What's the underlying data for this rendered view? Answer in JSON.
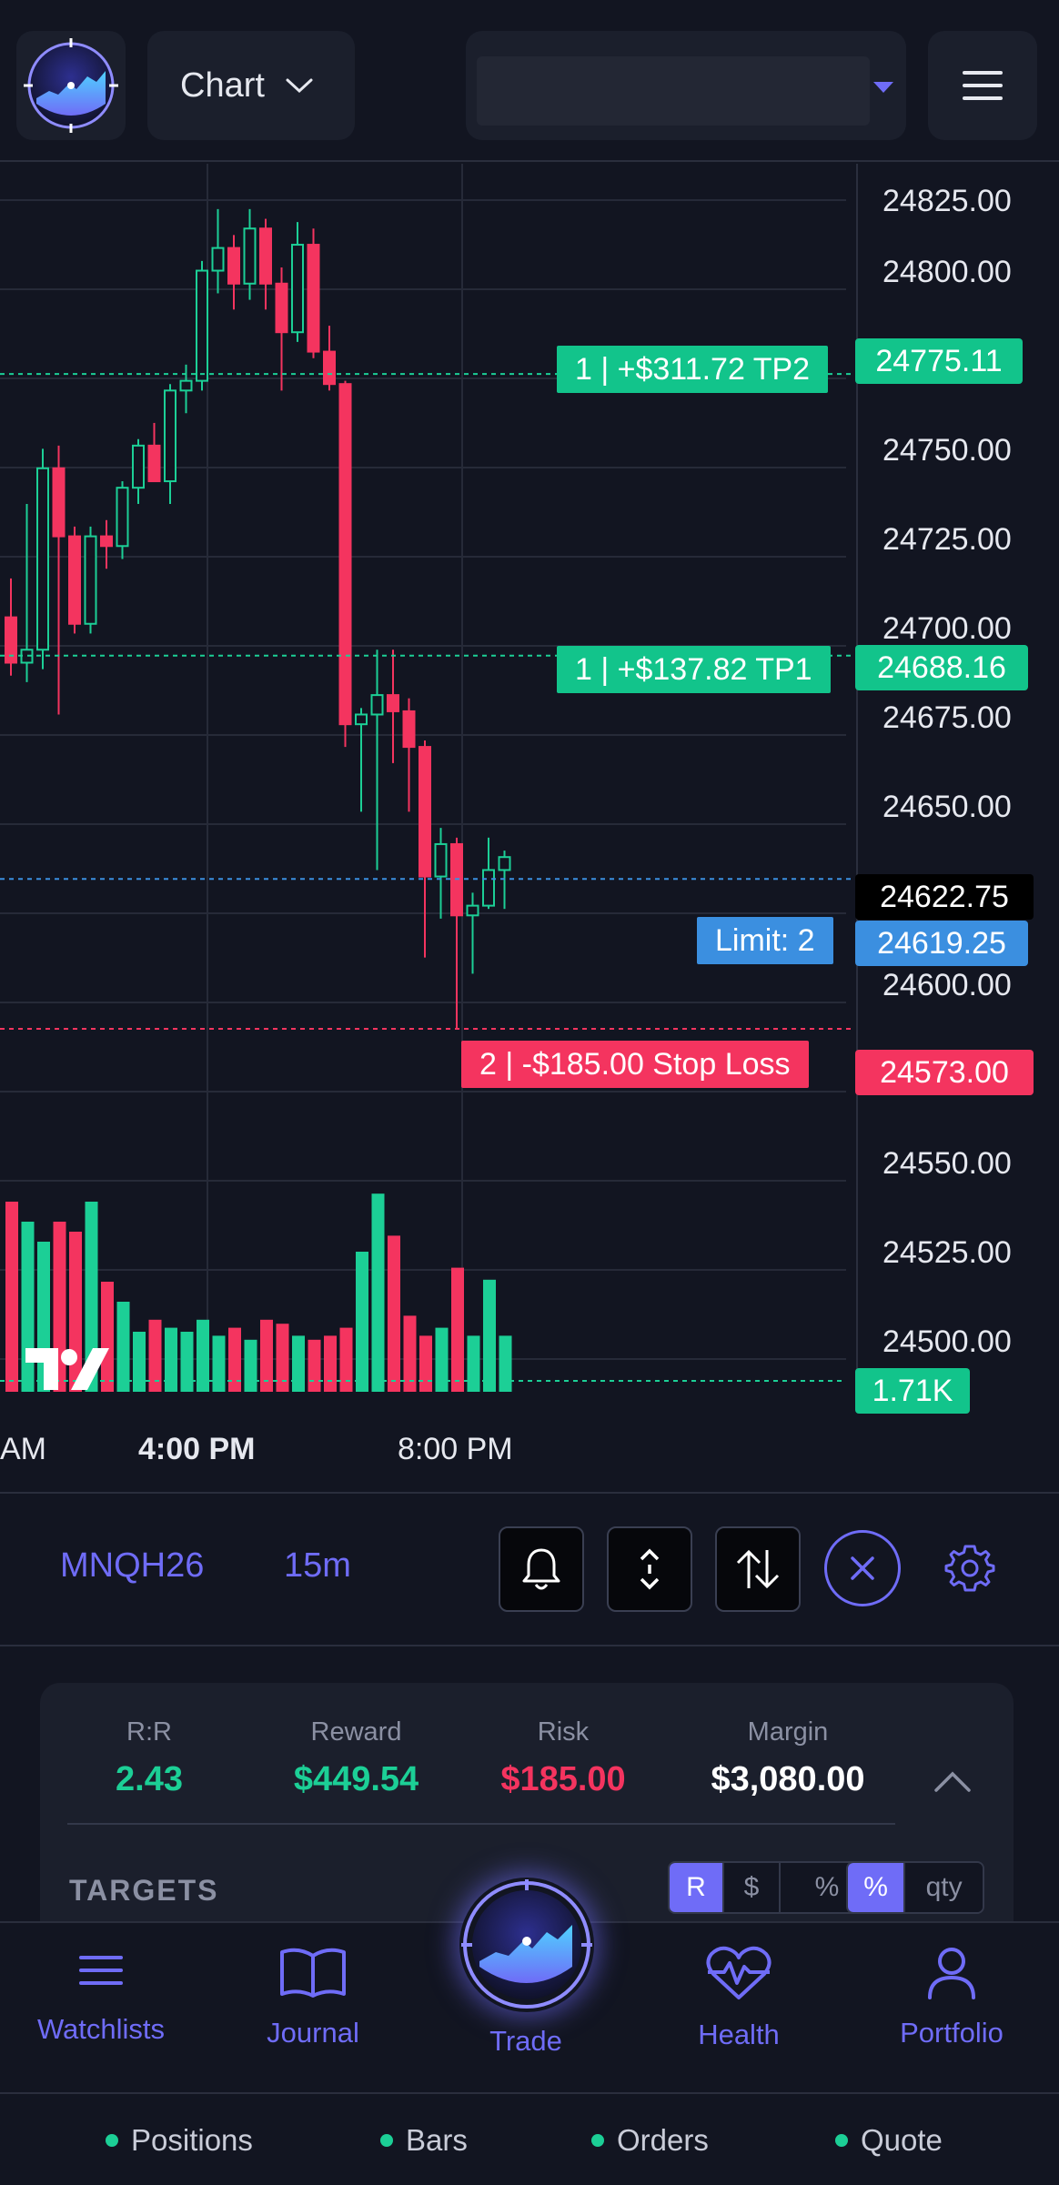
{
  "header": {
    "view_label": "Chart",
    "icons": {
      "logo": "radar-logo-icon",
      "chevron": "chevron-down-icon",
      "menu": "hamburger-menu-icon",
      "account_caret": "caret-down-icon"
    }
  },
  "chart": {
    "price_axis": [
      "24825.00",
      "24800.00",
      "24750.00",
      "24725.00",
      "24700.00",
      "24675.00",
      "24650.00",
      "24600.00",
      "24550.00",
      "24525.00",
      "24500.00"
    ],
    "time_axis": [
      "AM",
      "4:00 PM",
      "8:00 PM"
    ],
    "markers": {
      "tp2_price": "24775.11",
      "tp1_price": "24688.16",
      "last_price": "24622.75",
      "limit_price": "24619.25",
      "stop_price": "24573.00",
      "volume": "1.71K"
    },
    "orders": {
      "tp2": "1 | +$311.72 TP2",
      "tp1": "1 | +$137.82 TP1",
      "limit": "Limit: 2",
      "stop": "2 | -$185.00 Stop Loss"
    },
    "colors": {
      "up": "#1ccf96",
      "down": "#f4345f",
      "limit": "#3b8fe0",
      "background": "#121521",
      "grid": "#262a38"
    }
  },
  "chart_data": {
    "type": "candlestick",
    "y_range": [
      24475,
      24840
    ],
    "candles": [
      {
        "o": 24700,
        "h": 24712,
        "l": 24682,
        "c": 24686
      },
      {
        "o": 24686,
        "h": 24735,
        "l": 24680,
        "c": 24690
      },
      {
        "o": 24690,
        "h": 24752,
        "l": 24684,
        "c": 24746
      },
      {
        "o": 24746,
        "h": 24753,
        "l": 24670,
        "c": 24725
      },
      {
        "o": 24725,
        "h": 24728,
        "l": 24695,
        "c": 24698
      },
      {
        "o": 24698,
        "h": 24728,
        "l": 24695,
        "c": 24725
      },
      {
        "o": 24725,
        "h": 24730,
        "l": 24715,
        "c": 24722
      },
      {
        "o": 24722,
        "h": 24742,
        "l": 24718,
        "c": 24740
      },
      {
        "o": 24740,
        "h": 24755,
        "l": 24735,
        "c": 24753
      },
      {
        "o": 24753,
        "h": 24760,
        "l": 24742,
        "c": 24742
      },
      {
        "o": 24742,
        "h": 24772,
        "l": 24735,
        "c": 24770
      },
      {
        "o": 24770,
        "h": 24778,
        "l": 24763,
        "c": 24773
      },
      {
        "o": 24773,
        "h": 24810,
        "l": 24770,
        "c": 24807
      },
      {
        "o": 24807,
        "h": 24826,
        "l": 24800,
        "c": 24814
      },
      {
        "o": 24814,
        "h": 24818,
        "l": 24795,
        "c": 24803
      },
      {
        "o": 24803,
        "h": 24826,
        "l": 24798,
        "c": 24820
      },
      {
        "o": 24820,
        "h": 24823,
        "l": 24795,
        "c": 24803
      },
      {
        "o": 24803,
        "h": 24808,
        "l": 24770,
        "c": 24788
      },
      {
        "o": 24788,
        "h": 24822,
        "l": 24785,
        "c": 24815
      },
      {
        "o": 24815,
        "h": 24820,
        "l": 24780,
        "c": 24782
      },
      {
        "o": 24782,
        "h": 24790,
        "l": 24770,
        "c": 24772
      },
      {
        "o": 24772,
        "h": 24773,
        "l": 24660,
        "c": 24667
      },
      {
        "o": 24667,
        "h": 24672,
        "l": 24640,
        "c": 24670
      },
      {
        "o": 24670,
        "h": 24690,
        "l": 24622,
        "c": 24676
      },
      {
        "o": 24676,
        "h": 24690,
        "l": 24655,
        "c": 24671
      },
      {
        "o": 24671,
        "h": 24675,
        "l": 24640,
        "c": 24660
      },
      {
        "o": 24660,
        "h": 24662,
        "l": 24595,
        "c": 24620
      },
      {
        "o": 24620,
        "h": 24635,
        "l": 24607,
        "c": 24630
      },
      {
        "o": 24630,
        "h": 24632,
        "l": 24573,
        "c": 24608
      },
      {
        "o": 24608,
        "h": 24615,
        "l": 24590,
        "c": 24611
      },
      {
        "o": 24611,
        "h": 24632,
        "l": 24610,
        "c": 24622
      },
      {
        "o": 24622,
        "h": 24628,
        "l": 24610,
        "c": 24626
      }
    ],
    "volume_relative": [
      0.95,
      0.85,
      0.75,
      0.85,
      0.8,
      0.95,
      0.55,
      0.45,
      0.3,
      0.36,
      0.32,
      0.3,
      0.36,
      0.28,
      0.32,
      0.26,
      0.36,
      0.34,
      0.28,
      0.26,
      0.28,
      0.32,
      0.7,
      0.99,
      0.78,
      0.38,
      0.28,
      0.32,
      0.62,
      0.28,
      0.56,
      0.28
    ]
  },
  "toolbar": {
    "symbol": "MNQH26",
    "timeframe": "15m",
    "icons": [
      "bell-icon",
      "vertical-arrows-icon",
      "swap-arrows-icon",
      "close-icon",
      "gear-icon"
    ]
  },
  "stats": {
    "rr_label": "R:R",
    "rr_value": "2.43",
    "reward_label": "Reward",
    "reward_value": "$449.54",
    "risk_label": "Risk",
    "risk_value": "$185.00",
    "margin_label": "Margin",
    "margin_value": "$3,080.00",
    "targets_label": "TARGETS",
    "unit_options": [
      "R",
      "$",
      "%"
    ],
    "unit_selected": "R",
    "qty_options": [
      "%",
      "qty"
    ],
    "qty_selected": "%"
  },
  "nav": {
    "items": [
      "Watchlists",
      "Journal",
      "Trade",
      "Health",
      "Portfolio"
    ]
  },
  "status": {
    "items": [
      "Positions",
      "Bars",
      "Orders",
      "Quote"
    ]
  }
}
